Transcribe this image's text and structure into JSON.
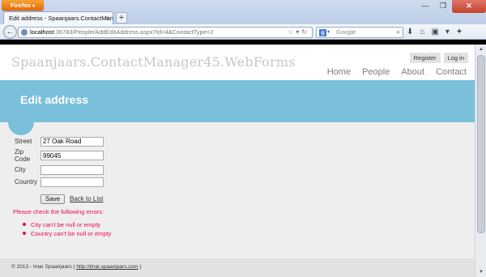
{
  "browser": {
    "app_button": "Firefox",
    "tab_title": "Edit address - Spaanjaars.ContactManager",
    "url_host": "localhost",
    "url_path": ":36783/People/AddEditAddress.aspx?Id=4&ContactType=2",
    "search_placeholder": "Google",
    "icons": [
      "back-icon",
      "star-icon",
      "reload-icon",
      "download-icon",
      "home-icon",
      "bookmarks-icon",
      "addons-icon"
    ]
  },
  "site": {
    "title": "Spaanjaars.ContactManager45.WebForms",
    "login_links": [
      "Register",
      "Log in"
    ],
    "nav": [
      "Home",
      "People",
      "About",
      "Contact"
    ]
  },
  "page": {
    "heading": "Edit address",
    "form": {
      "fields": [
        {
          "label": "Street",
          "value": "27 Oak Road"
        },
        {
          "label": "Zip Code",
          "value": "99045"
        },
        {
          "label": "City",
          "value": ""
        },
        {
          "label": "Country",
          "value": ""
        }
      ],
      "save_label": "Save",
      "back_label": "Back to List"
    },
    "validation": {
      "header": "Please check the following errors:",
      "errors": [
        "City can't be null or empty",
        "Country can't be null or empty"
      ]
    },
    "footer": {
      "text": "© 2013 - Imar Spaanjaars (",
      "link": "http://imar.spaanjaars.com",
      "close": ")"
    }
  },
  "colors": {
    "featured": "#7ac0da",
    "error": "#e80c4d",
    "title_gray": "#c6c6c6"
  }
}
